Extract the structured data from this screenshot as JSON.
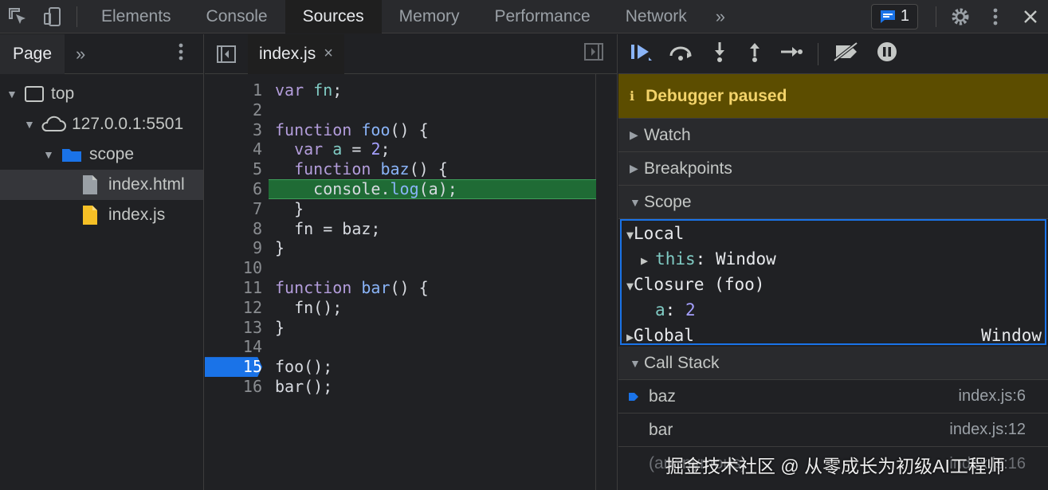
{
  "topbar": {
    "tabs": [
      "Elements",
      "Console",
      "Sources",
      "Memory",
      "Performance",
      "Network"
    ],
    "active_tab": "Sources",
    "more": "»",
    "issues_count": "1"
  },
  "left": {
    "tab": "Page",
    "more": "»",
    "tree": {
      "top": "top",
      "host": "127.0.0.1:5501",
      "folder": "scope",
      "file_html": "index.html",
      "file_js": "index.js"
    }
  },
  "editor": {
    "file_tab": "index.js",
    "close": "×",
    "lines": [
      {
        "n": "1",
        "html": "<span class='kw'>var</span> <span class='id'>fn</span>;"
      },
      {
        "n": "2",
        "html": ""
      },
      {
        "n": "3",
        "html": "<span class='kw'>function</span> <span class='fnc'>foo</span>() {"
      },
      {
        "n": "4",
        "html": "  <span class='kw'>var</span> <span class='id'>a</span> = <span class='num'>2</span>;"
      },
      {
        "n": "5",
        "html": "  <span class='kw'>function</span> <span class='fnc'>baz</span>() {"
      },
      {
        "n": "6",
        "html": "    console.<span class='fnc'>log</span>(a);"
      },
      {
        "n": "7",
        "html": "  }"
      },
      {
        "n": "8",
        "html": "  fn = baz;"
      },
      {
        "n": "9",
        "html": "}"
      },
      {
        "n": "10",
        "html": ""
      },
      {
        "n": "11",
        "html": "<span class='kw'>function</span> <span class='fnc'>bar</span>() {"
      },
      {
        "n": "12",
        "html": "  fn();"
      },
      {
        "n": "13",
        "html": "}"
      },
      {
        "n": "14",
        "html": ""
      },
      {
        "n": "15",
        "html": "foo();"
      },
      {
        "n": "16",
        "html": "bar();"
      }
    ],
    "exec_line": "6",
    "breakpoint_line": "15"
  },
  "debugger": {
    "paused": "Debugger paused",
    "watch": "Watch",
    "breakpoints": "Breakpoints",
    "scope": "Scope",
    "scope_local": "Local",
    "this_key": "this",
    "this_val": "Window",
    "closure": "Closure (foo)",
    "a_key": "a",
    "a_val": "2",
    "global": "Global",
    "global_val": "Window",
    "call_stack": "Call Stack",
    "stack": [
      {
        "fn": "baz",
        "loc": "index.js:6"
      },
      {
        "fn": "bar",
        "loc": "index.js:12"
      },
      {
        "fn": "(anonymous)",
        "loc": "index.js:16"
      }
    ]
  },
  "watermark": "掘金技术社区 @ 从零成长为初级AI工程师",
  "colors": {
    "accent": "#1a73e8",
    "exec_bg": "#1f6b35",
    "paused_bg": "#5c4d00"
  }
}
